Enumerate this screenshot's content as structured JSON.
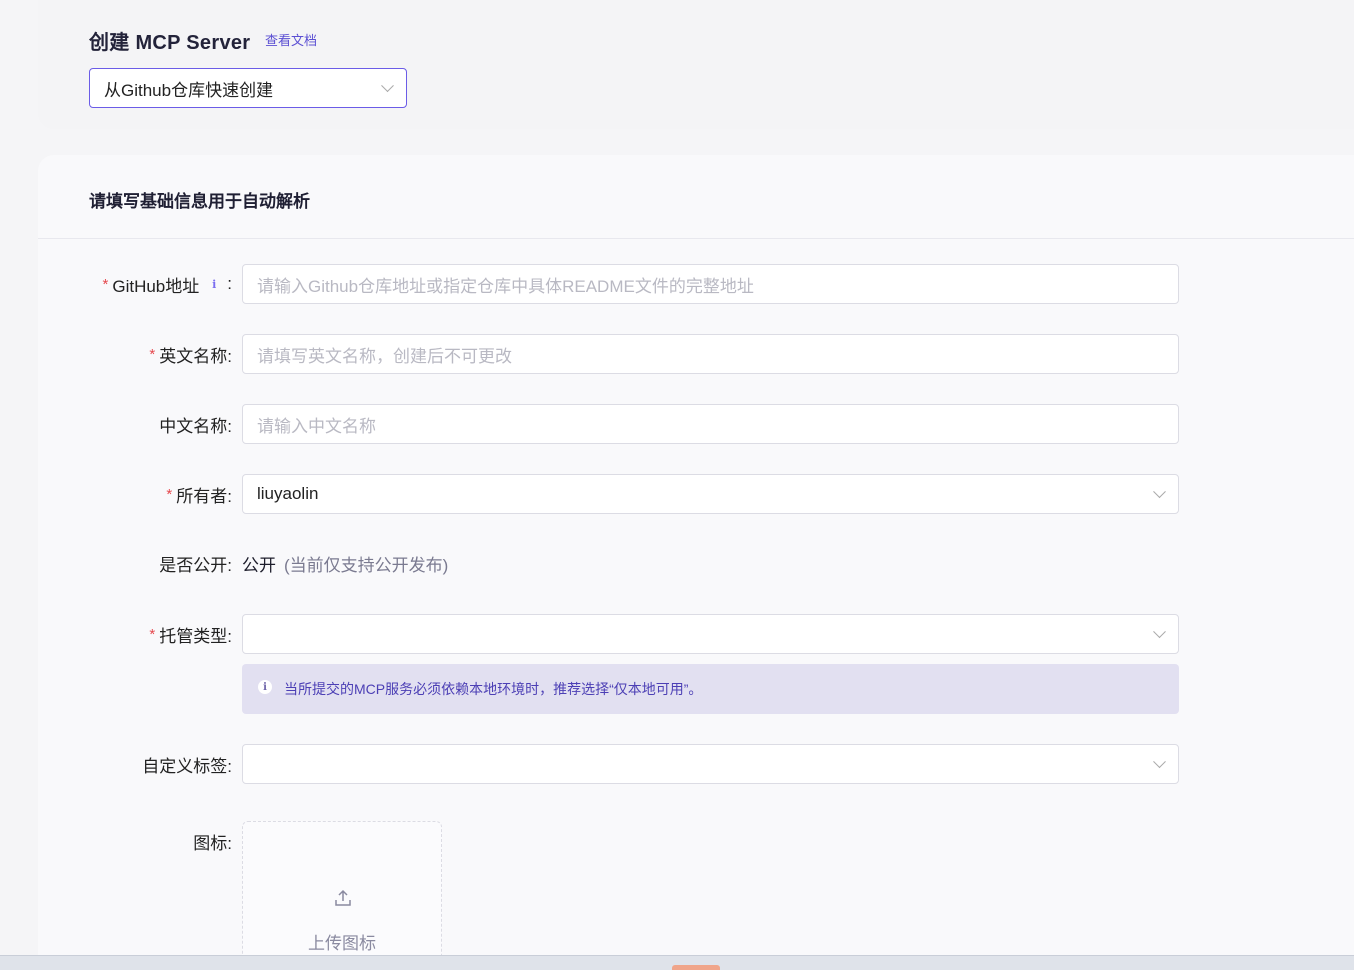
{
  "header": {
    "title": "创建 MCP Server",
    "doc_link": "查看文档",
    "mode_select_value": "从Github仓库快速创建"
  },
  "section": {
    "title": "请填写基础信息用于自动解析"
  },
  "form": {
    "github": {
      "label": "GitHub地址",
      "colon": ":",
      "placeholder": "请输入Github仓库地址或指定仓库中具体README文件的完整地址",
      "required": true
    },
    "english_name": {
      "label": "英文名称:",
      "placeholder": "请填写英文名称，创建后不可更改",
      "required": true
    },
    "chinese_name": {
      "label": "中文名称:",
      "placeholder": "请输入中文名称",
      "required": false
    },
    "owner": {
      "label": "所有者:",
      "value": "liuyaolin",
      "required": true
    },
    "public": {
      "label": "是否公开:",
      "value": "公开",
      "hint": "(当前仅支持公开发布)"
    },
    "hosting_type": {
      "label": "托管类型:",
      "value": "",
      "required": true,
      "notice": "当所提交的MCP服务必须依赖本地环境时，推荐选择“仅本地可用”。"
    },
    "custom_tags": {
      "label": "自定义标签:",
      "value": ""
    },
    "icon": {
      "label": "图标:",
      "upload_text": "上传图标"
    }
  },
  "colors": {
    "accent": "#6b5ce7",
    "required": "#e5484d",
    "notice_bg": "#e2e0f1"
  }
}
